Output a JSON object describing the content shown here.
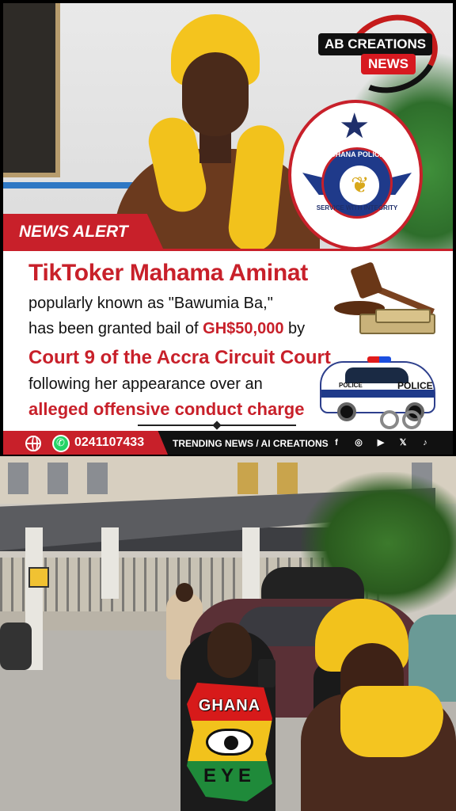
{
  "brand": {
    "title": "AB CREATIONS",
    "subtitle": "NEWS"
  },
  "badge": {
    "name": "GHANA POLICE",
    "motto": "SERVICE WITH INTEGRITY"
  },
  "alert_label": "NEWS ALERT",
  "story": {
    "headline": "TikToker Mahama Aminat",
    "line1": "popularly known as \"Bawumia Ba,\"",
    "line2_prefix": "has been granted bail of ",
    "line2_amount": "GH$50,000",
    "line2_suffix": " by",
    "line3": "Court 9 of the Accra Circuit Court",
    "line4": "following her appearance over an",
    "line5": "alleged offensive conduct charge"
  },
  "car": {
    "label": "POLICE",
    "label_small": "POLICE"
  },
  "footer": {
    "phone": "0241107433",
    "tagline": "TRENDING NEWS / AI CREATIONS",
    "social": [
      "f",
      "◎",
      "▶",
      "𝕏",
      "♪"
    ]
  },
  "watermark": {
    "top": "GHANA",
    "bottom": "EYE"
  },
  "colors": {
    "brand_red": "#c8202a",
    "scarf_yellow": "#f2c21c",
    "police_blue": "#1f3a8a"
  }
}
